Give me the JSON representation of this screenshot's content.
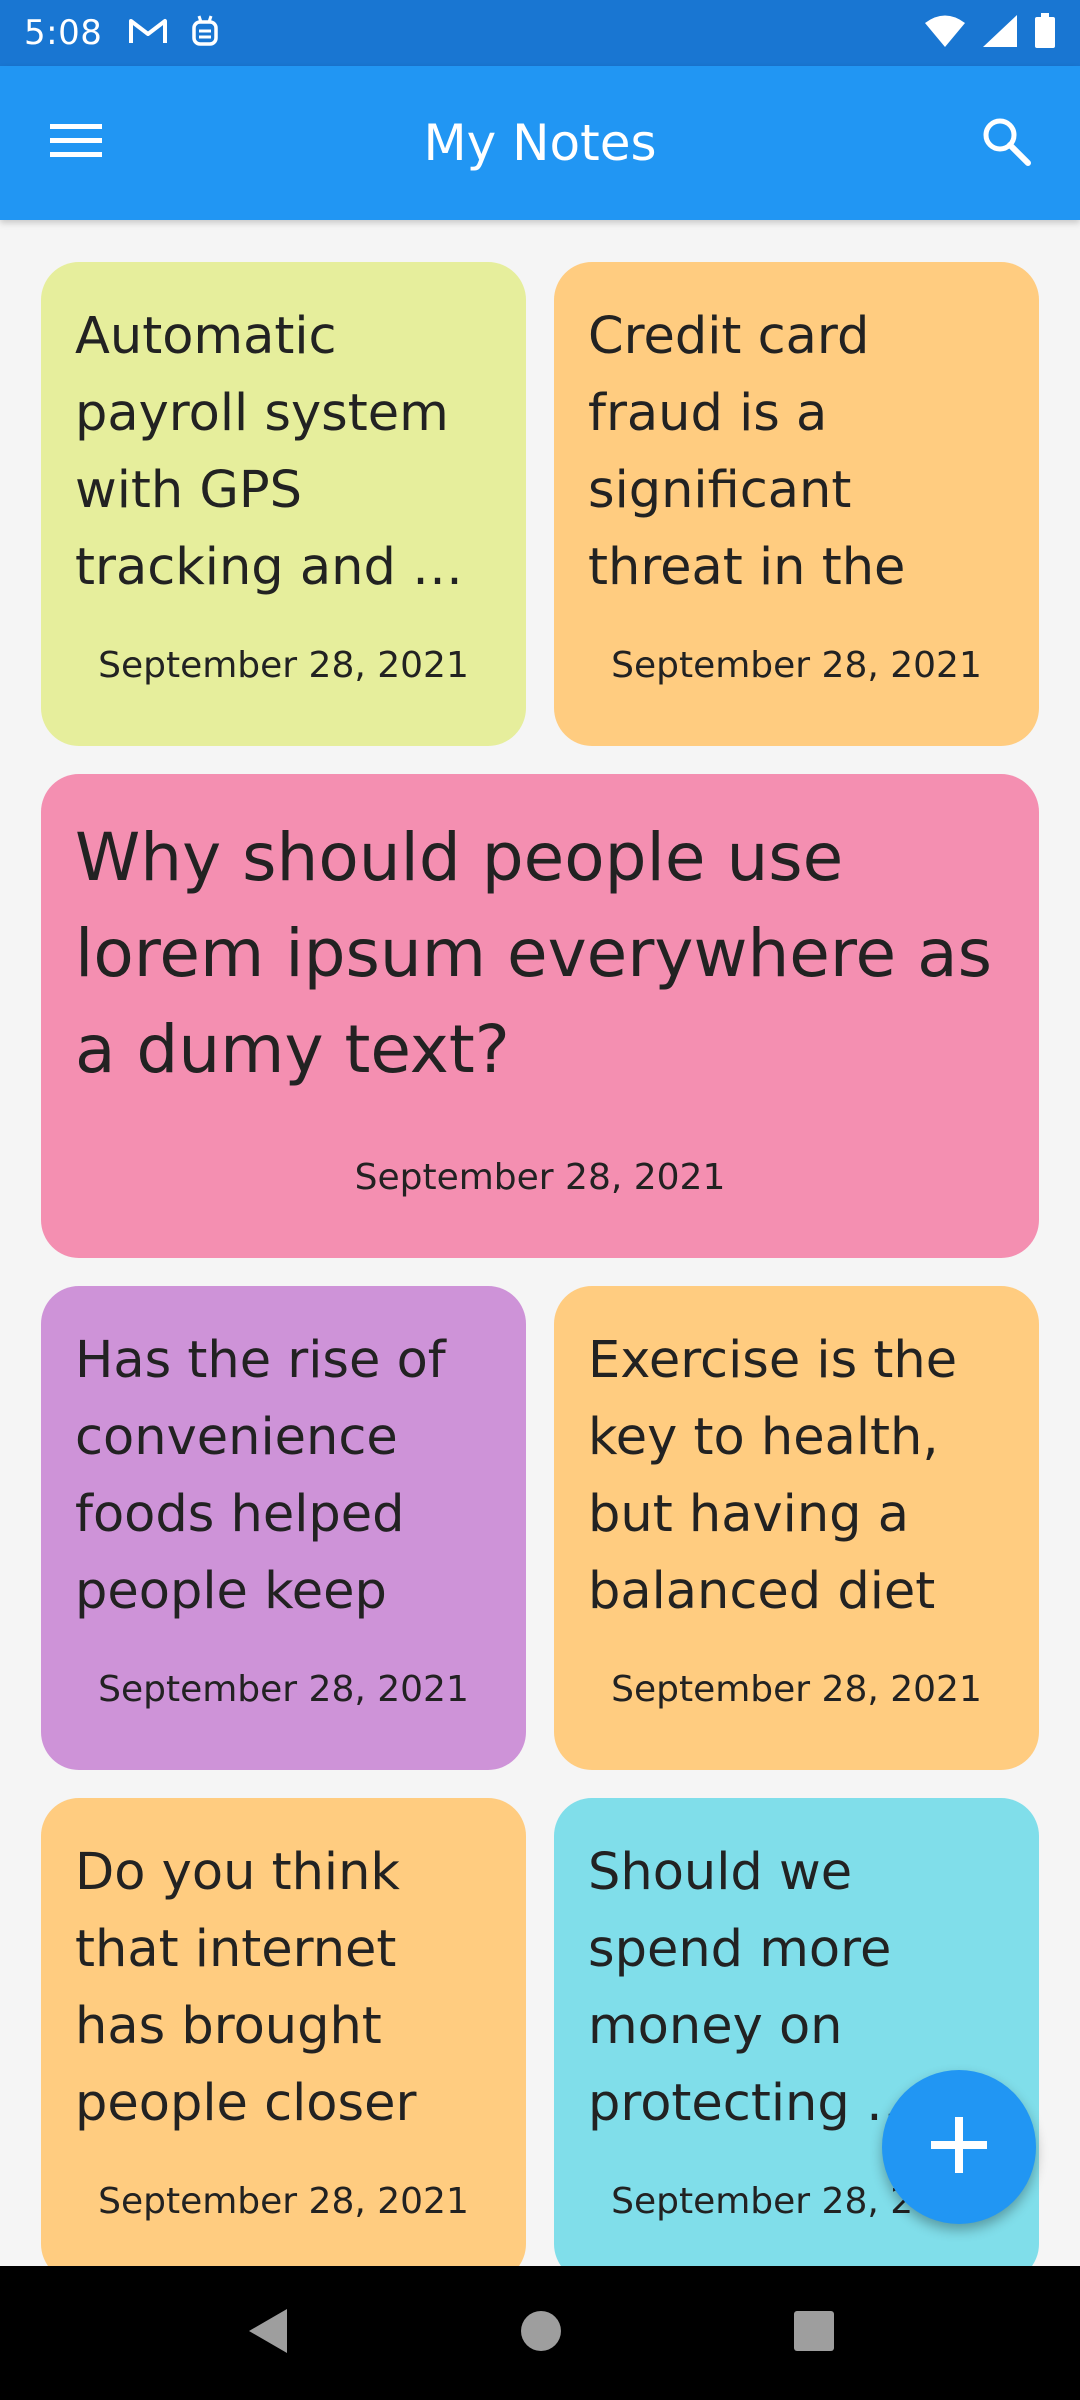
{
  "status_bar": {
    "time": "5:08",
    "left_icons": [
      "gmail-icon",
      "android-debug-icon"
    ],
    "right_icons": [
      "wifi-icon",
      "signal-icon",
      "battery-icon"
    ]
  },
  "app_bar": {
    "title": "My Notes",
    "menu_icon": "menu-icon",
    "search_icon": "search-icon",
    "color": "#2196f3"
  },
  "notes": [
    {
      "title": "Automatic payroll system with GPS tracking and …",
      "date": "September 28, 2021",
      "color": "#e6ee9c"
    },
    {
      "title": "Credit card fraud is a significant threat in the FBSI section.",
      "date": "September 28, 2021",
      "color": "#ffcc80"
    },
    {
      "title": "Why should people use lorem ipsum everywhere as a dumy text?",
      "date": "September 28, 2021",
      "color": "#f48fb1"
    },
    {
      "title": "Has the rise of convenience foods helped people keep up…",
      "date": "September 28, 2021",
      "color": "#ce93d8"
    },
    {
      "title": "Exercise is the key to health, but having a balanced diet i…",
      "date": "September 28, 2021",
      "color": "#ffcc80"
    },
    {
      "title": "Do you think that internet has brought people closer together…",
      "date": "September 28, 2021",
      "color": "#ffcc80"
    },
    {
      "title": "Should we spend more money on protecting …",
      "date": "September 28, 2021",
      "color": "#80deea"
    }
  ],
  "fab": {
    "icon": "plus-icon",
    "color": "#2196f3"
  },
  "nav_bar": {
    "icons": [
      "back-icon",
      "home-icon",
      "recents-icon"
    ]
  }
}
